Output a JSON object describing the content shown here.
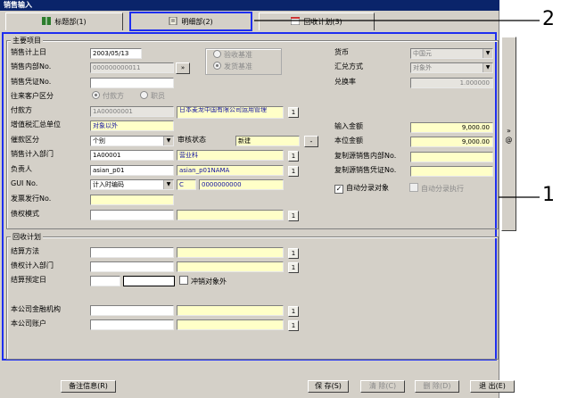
{
  "window": {
    "title": "销售输入"
  },
  "tabs": [
    {
      "label": "标题部(1)"
    },
    {
      "label": "明细部(2)"
    },
    {
      "label": "回收计划(3)"
    }
  ],
  "header_group": {
    "title": "主要项目",
    "sales_date": {
      "label": "销售计上日",
      "value": "2003/05/13"
    },
    "internal_no": {
      "label": "销售内部No.",
      "value": "000000000011",
      "button": "»"
    },
    "voucher_no": {
      "label": "销售凭证No.",
      "value": ""
    },
    "basis": {
      "option1": "验收基准",
      "option2": "发货基准",
      "selected": "option2"
    },
    "partner_type": {
      "label": "往来客户区分",
      "option1": "付款方",
      "option2": "职员",
      "selected": "option1"
    },
    "payer": {
      "label": "付款方",
      "code": "1A00000001",
      "name": "日本麦龙中国有限公司运用管理"
    },
    "vat_unit": {
      "label": "增值税汇总单位",
      "value": "对象以外"
    },
    "dunning": {
      "label": "催款区分",
      "value": "个别"
    },
    "approval": {
      "label": "审核状态",
      "value": "新建",
      "button": "-"
    },
    "dept": {
      "label": "销售计入部门",
      "code": "1A00001",
      "name": "营业科"
    },
    "person": {
      "label": "负责人",
      "code": "asian_p01",
      "name": "asian_p01NAMA"
    },
    "gui": {
      "label": "GUI No.",
      "select": "计入时编码",
      "code": "C",
      "number": "0000000000"
    },
    "invoice_no": {
      "label": "发票发行No.",
      "value": ""
    },
    "credit": {
      "label": "债权模式",
      "value": ""
    },
    "currency": {
      "label": "货币",
      "value": "中国元"
    },
    "rate_method": {
      "label": "汇兑方式",
      "value": "对象外"
    },
    "rate": {
      "label": "兑换率",
      "value": "1.000000"
    },
    "input_amount": {
      "label": "输入金额",
      "value": "9,000.00"
    },
    "local_amount": {
      "label": "本位金额",
      "value": "9,000.00"
    },
    "copy_internal": {
      "label": "复制源销售内部No.",
      "value": ""
    },
    "copy_voucher": {
      "label": "复制源销售凭证No.",
      "value": ""
    },
    "auto_split": {
      "label": "自动分录对象",
      "checked": true
    },
    "auto_exec": {
      "label": "自动分录执行",
      "checked": false
    },
    "side_button": "»\n@"
  },
  "collect_group": {
    "title": "回收计划",
    "settle_method": {
      "label": "结算方法"
    },
    "credit_dept": {
      "label": "债权计入部门"
    },
    "settle_date": {
      "label": "结算预定日"
    },
    "offset": {
      "label": "冲销对象外",
      "checked": false
    },
    "bank": {
      "label": "本公司金融机构"
    },
    "account": {
      "label": "本公司账户"
    }
  },
  "footer": {
    "remarks": "备注信息(R)",
    "save": "保 存(S)",
    "clear": "清 除(C)",
    "delete": "删 除(D)",
    "exit": "退 出(E)"
  },
  "callouts": {
    "one": "1",
    "two": "2"
  },
  "colors": {
    "highlight": "#1e2ef0",
    "title_bar": "#0a246a",
    "field_yellow": "#ffffc8"
  }
}
